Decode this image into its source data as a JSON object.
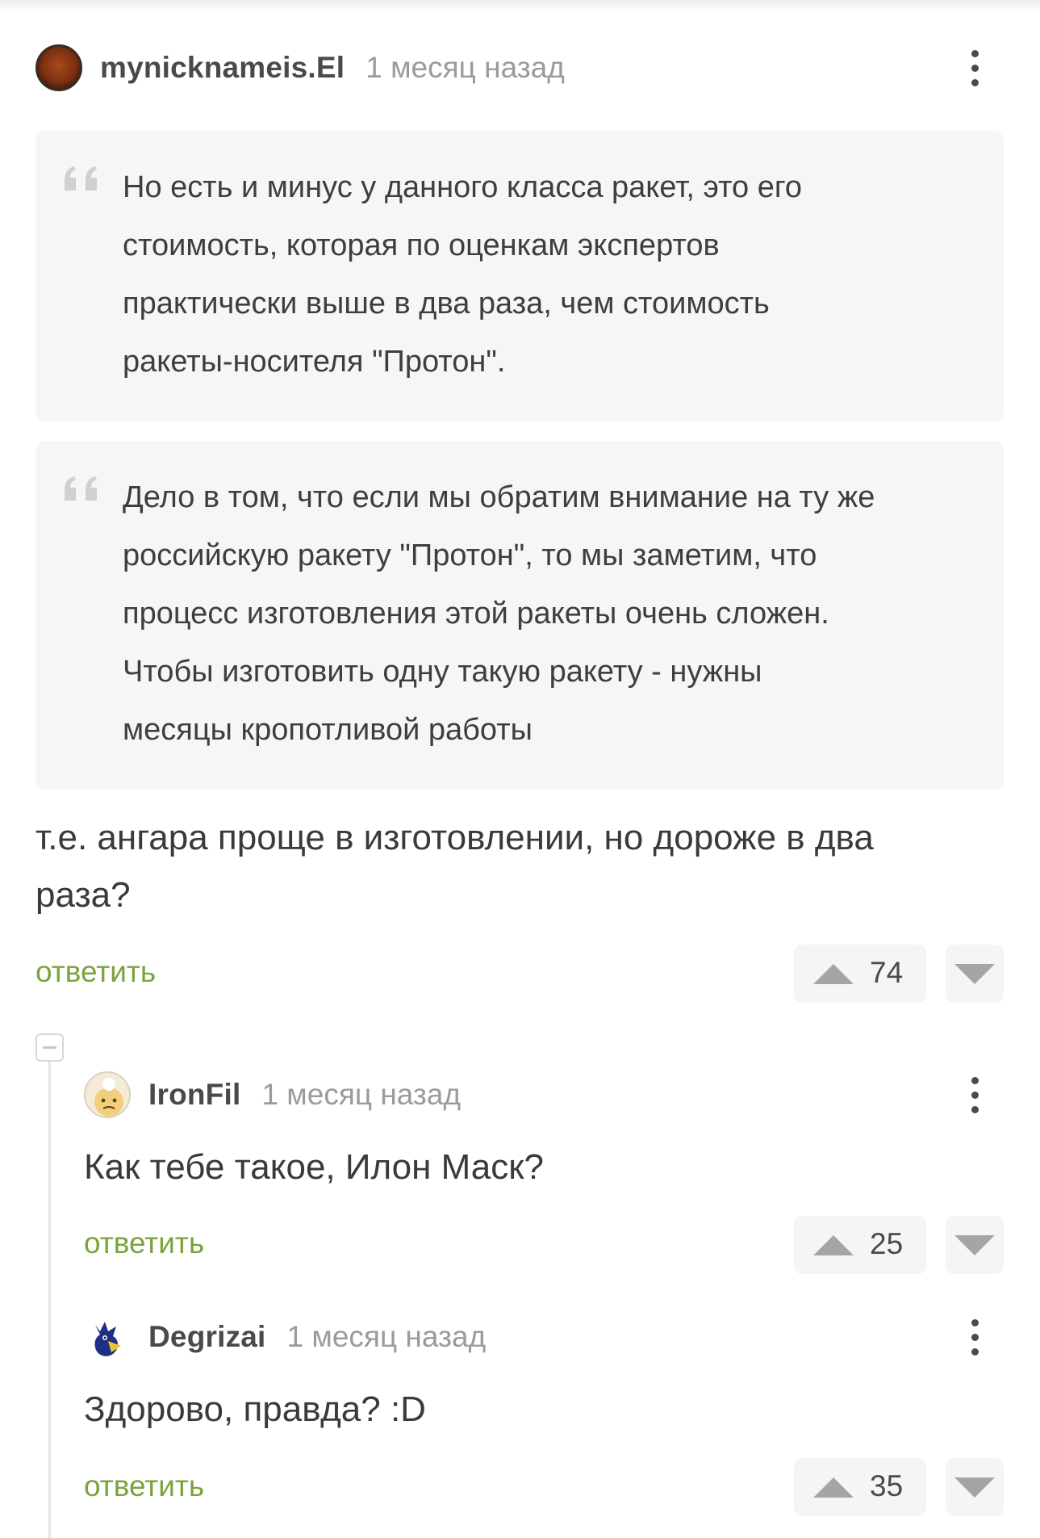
{
  "main_comment": {
    "author": "mynicknameis.El",
    "time": "1 месяц назад",
    "quotes": [
      {
        "lines": [
          "Но есть и минус у данного класса ракет, это его",
          "стоимость, которая по оценкам экспертов",
          "практически выше в два раза, чем стоимость",
          "ракеты-носителя \"Протон\"."
        ]
      },
      {
        "lines": [
          "Дело в том, что если мы обратим внимание на ту же",
          "российскую ракету \"Протон\", то мы заметим, что",
          "процесс изготовления этой ракеты очень сложен.",
          "Чтобы изготовить одну такую ракету - нужны",
          "месяцы кропотливой работы"
        ]
      }
    ],
    "text_lines": [
      "т.е. ангара проще в изготовлении, но дороже в два",
      "раза?"
    ],
    "reply_label": "ответить",
    "rating": "74"
  },
  "replies": [
    {
      "author": "IronFil",
      "time": "1 месяц назад",
      "text": "Как тебе такое, Илон Маск?",
      "reply_label": "ответить",
      "rating": "25"
    },
    {
      "author": "Degrizai",
      "time": "1 месяц назад",
      "text": "Здорово, правда? :D",
      "reply_label": "ответить",
      "rating": "35"
    }
  ],
  "icons": {
    "more": "more-vertical-icon",
    "quote": "quote-icon",
    "vote_up": "arrow-up-icon",
    "vote_down": "arrow-down-icon",
    "collapse": "collapse-thread-icon"
  },
  "colors": {
    "reply_link": "#7aa33d",
    "quote_bg": "#f6f6f6",
    "vote_arrow": "#a5a5a5",
    "time_text": "#9b9b9b"
  }
}
